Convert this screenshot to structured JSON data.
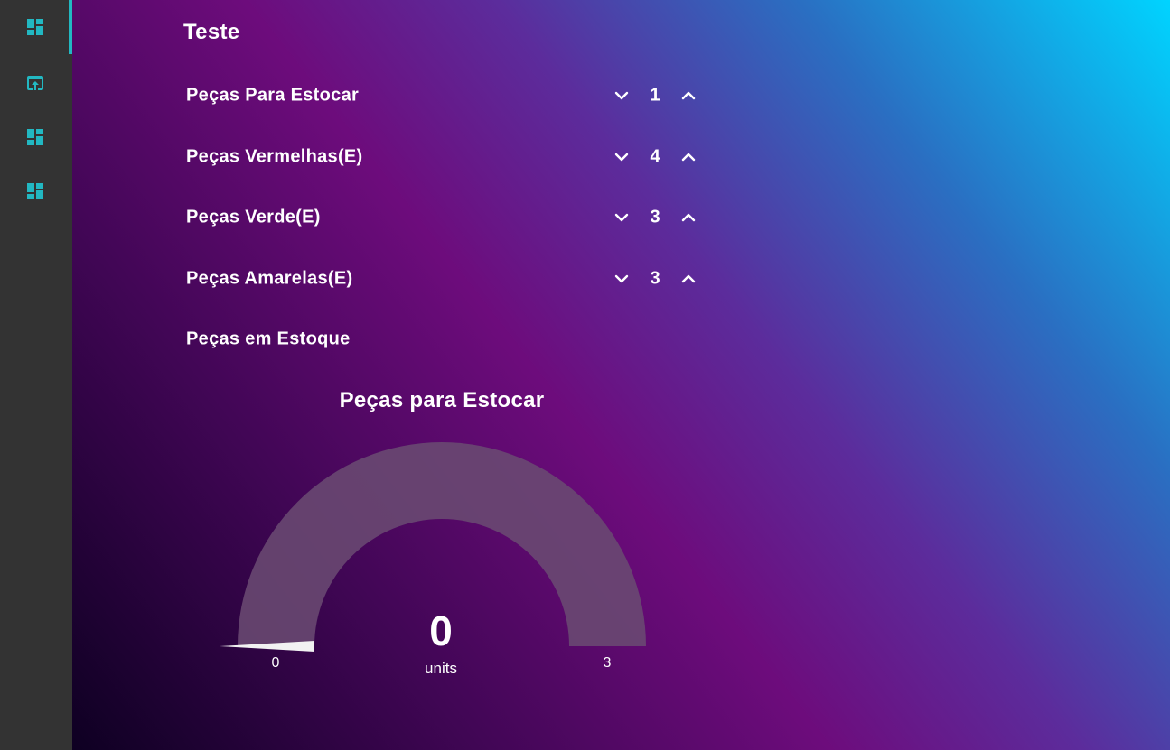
{
  "sidebar": {
    "items": [
      {
        "icon": "dashboard-icon",
        "active": true
      },
      {
        "icon": "open-in-browser-icon",
        "active": false
      },
      {
        "icon": "dashboard-icon",
        "active": false
      },
      {
        "icon": "dashboard-icon",
        "active": false
      }
    ],
    "accent_color": "#22b8c2"
  },
  "page": {
    "title": "Teste"
  },
  "counters": [
    {
      "label": "Peças Para Estocar",
      "value": "1"
    },
    {
      "label": "Peças Vermelhas(E)",
      "value": "4"
    },
    {
      "label": "Peças Verde(E)",
      "value": "3"
    },
    {
      "label": "Peças Amarelas(E)",
      "value": "3"
    }
  ],
  "stock_section": {
    "label": "Peças em Estoque"
  },
  "gauge": {
    "title": "Peças para Estocar",
    "value": "0",
    "units": "units",
    "min": "0",
    "max": "3"
  },
  "chart_data": {
    "type": "gauge",
    "title": "Peças para Estocar",
    "value": 0,
    "min": 0,
    "max": 3,
    "units": "units",
    "colors": {
      "track": "#6a4a72",
      "needle": "#f2f2f2"
    }
  }
}
